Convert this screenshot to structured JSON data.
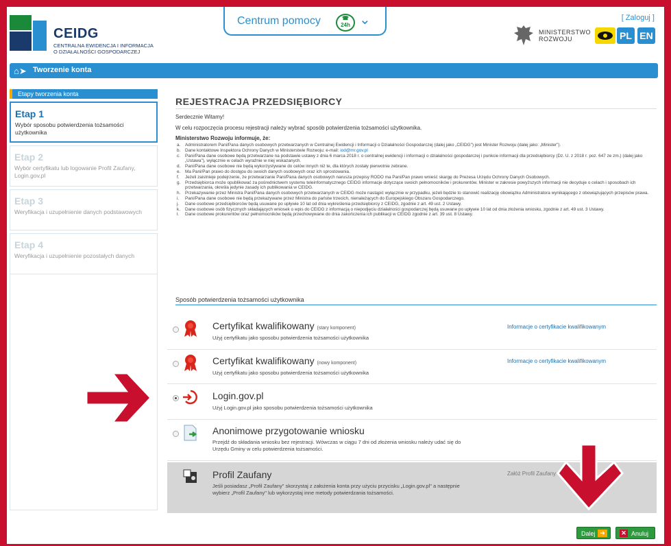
{
  "header": {
    "logo_title": "CEIDG",
    "logo_sub_line1": "CENTRALNA EWIDENCJA I INFORMACJA",
    "logo_sub_line2": "O DZIAŁALNOŚCI GOSPODARCZEJ",
    "help_label": "Centrum pomocy",
    "help_badge": "24h",
    "login_link": "[ Zaloguj ]",
    "ministry_line1": "MINISTERSTWO",
    "ministry_line2": "ROZWOJU",
    "lang_pl": "PL",
    "lang_en": "EN"
  },
  "nav": {
    "breadcrumb": "Tworzenie konta"
  },
  "sidebar": {
    "heading": "Etapy tworzenia konta",
    "steps": [
      {
        "title": "Etap 1",
        "desc": "Wybór sposobu potwierdzenia tożsamości użytkownika"
      },
      {
        "title": "Etap 2",
        "desc": "Wybór certyfikatu lub logowanie Profil Zaufany, Login.gov.pl"
      },
      {
        "title": "Etap 3",
        "desc": "Weryfikacja i uzupełnienie danych podstawowych"
      },
      {
        "title": "Etap 4",
        "desc": "Weryfikacja i uzupełnienie pozostałych danych"
      }
    ]
  },
  "main": {
    "title": "REJESTRACJA PRZEDSIĘBIORCY",
    "greeting": "Serdecznie Witamy!",
    "intro": "W celu rozpoczęcia procesu rejestracji należy wybrać sposób potwierdzenia tożsamości użytkownika.",
    "ministry_heading": "Ministerstwo Rozwoju informuje, że:",
    "info_items": [
      {
        "marker": "a.",
        "text": "Administratorem Pani/Pana danych osobowych przetwarzanych w Centralnej Ewidencji i Informacji o Działalności Gospodarczej (dalej jako „CEIDG\") jest Minister Rozwoju (dalej jako: „Minister\")."
      },
      {
        "marker": "b.",
        "text": "Dane kontaktowe Inspektora Ochrony Danych w Ministerstwie Rozwoju: e-mail:",
        "link": "iod@mr.gov.pl"
      },
      {
        "marker": "c.",
        "text": "Pani/Pana dane osobowe będą przetwarzane na podstawie ustawy z dnia 6 marca 2018 r. o centralnej ewidencji i informacji o działalności gospodarczej i punkcie informacji dla przedsiębiorcy (Dz. U. z 2018 r. poz. 647 ze zm.) (dalej jako „Ustawa\"), wyłącznie w celach wyraźnie w niej wskazanych."
      },
      {
        "marker": "d.",
        "text": "Pani/Pana dane osobowe nie będą wykorzystywane do celów innych niż te, dla których zostały pierwotnie zebrane."
      },
      {
        "marker": "e.",
        "text": "Ma Pani/Pan prawo do dostępu do swoich danych osobowych oraz ich sprostowania."
      },
      {
        "marker": "f.",
        "text": "Jeżeli zaistnieje podejrzenie, że przetwarzanie Pani/Pana danych osobowych narusza przepisy RODO ma Pani/Pan prawo wnieść skargę do Prezesa Urzędu Ochrony Danych Osobowych."
      },
      {
        "marker": "g.",
        "text": "Przedsiębiorca może opublikować za pośrednictwem systemu teleinformatycznego CEIDG informacje dotyczące swoich pełnomocników i prokurentów. Minister w zakresie powyższych informacji nie decyduje o celach i sposobach ich przetwarzania, określa jedynie zasady ich publikowania w CEIDG."
      },
      {
        "marker": "h.",
        "text": "Przekazywanie przez Ministra Pani/Pana danych osobowych przetwarzanych w CEIDG może nastąpić wyłącznie w przypadku, jeżeli będzie to stanowić realizację obowiązku Administratora wynikającego z obowiązujących przepisów prawa."
      },
      {
        "marker": "i.",
        "text": "Pani/Pana dane osobowe nie będą przekazywane przez Ministra do państw trzecich, nienależących do Europejskiego Obszaru Gospodarczego."
      },
      {
        "marker": "j.",
        "text": "Dane osobowe przedsiębiorców będą usuwane po upływie 10 lat od dnia wykreślenia przedsiębiorcy z CEIDG, zgodnie z art. 49 ust. 2 Ustawy."
      },
      {
        "marker": "k.",
        "text": "Dane osobowe osób fizycznych składających wniosek o wpis do CEIDG z informacją o niepodjęciu działalności gospodarczej będą usuwane po upływie 10 lat od dnia złożenia wniosku, zgodnie z art. 49 ust. 3 Ustawy."
      },
      {
        "marker": "l.",
        "text": "Dane osobowe prokurentów oraz pełnomocników będą przechowywane do dnia zakończenia ich publikacji w CEIDG zgodnie z art. 39 ust. 8 Ustawy."
      }
    ],
    "section_label": "Sposób potwierdzenia tożsamości użytkownika",
    "options": [
      {
        "title": "Certyfikat kwalifikowany",
        "tag": "(stary komponent)",
        "desc": "Użyj certyfikatu jako sposobu potwierdzenia tożsamości użytkownika",
        "link": "Informacje o certyfikacie kwalifikowanym",
        "icon": "ribbon-icon"
      },
      {
        "title": "Certyfikat kwalifikowany",
        "tag": "(nowy komponent)",
        "desc": "Użyj certyfikatu jako sposobu potwierdzenia tożsamości użytkownika",
        "link": "Informacje o certyfikacie kwalifikowanym",
        "icon": "ribbon-icon"
      },
      {
        "title": "Login.gov.pl",
        "tag": "",
        "desc": "Użyj Login.gov.pl jako sposobu potwierdzenia tożsamości użytkownika",
        "link": "",
        "icon": "login-gov-icon",
        "selected": true
      },
      {
        "title": "Anonimowe przygotowanie wniosku",
        "tag": "",
        "desc": "Przejdź do składania wniosku bez rejestracji. Wówczas w ciągu 7 dni od złożenia wniosku należy udać się do Urzędu Gminy w celu potwierdzenia tożsamości.",
        "link": "",
        "icon": "document-arrow-icon"
      },
      {
        "title": "Profil Zaufany",
        "tag": "",
        "desc": "Jeśli posiadasz „Profil Zaufany\" skorzystaj z założenia konta przy użyciu przycisku „Login.gov.pl\" a następnie wybierz „Profil Zaufany\" lub wykorzystaj inne metody potwierdzania tożsamości.",
        "link": "Załóż Profil Zaufany",
        "icon": "profile-card-icon"
      }
    ]
  },
  "buttons": {
    "next": "Dalej",
    "cancel": "Anuluj"
  },
  "colors": {
    "accent": "#2a8fd0",
    "frame": "#c8102e",
    "button": "#2e9a3e"
  }
}
